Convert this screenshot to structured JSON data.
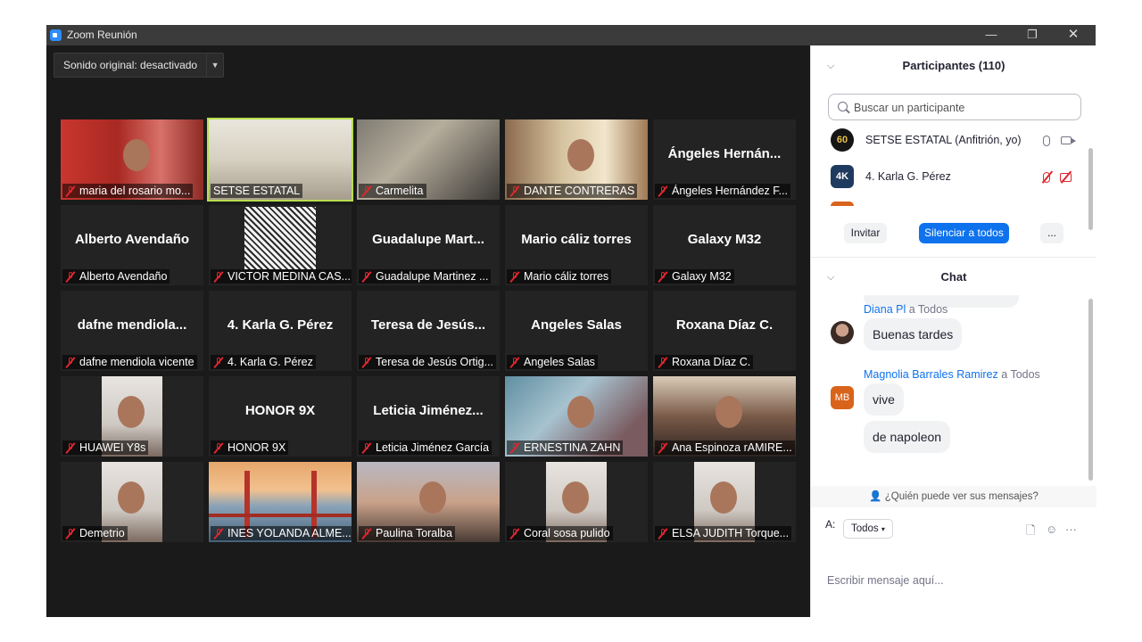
{
  "window": {
    "title": "Zoom Reunión",
    "minimize": "—",
    "restore": "❐",
    "close": "✕"
  },
  "meeting": {
    "sound_label": "Sonido original: desactivado",
    "dropdown_icon": "▼",
    "tiles": [
      {
        "name": "maria del rosario mo...",
        "big": "",
        "video": "redwall",
        "muted": true
      },
      {
        "name": "SETSE ESTATAL",
        "big": "",
        "video": "room",
        "muted": false,
        "selected": true
      },
      {
        "name": "Carmelita",
        "big": "",
        "video": "dark",
        "muted": true
      },
      {
        "name": "DANTE CONTRERAS",
        "big": "",
        "video": "warm",
        "muted": true
      },
      {
        "name": "Ángeles Hernández F...",
        "big": "Ángeles  Hernán...",
        "video": "",
        "muted": true
      },
      {
        "name": "Alberto Avendaño",
        "big": "Alberto Avendaño",
        "video": "",
        "muted": true
      },
      {
        "name": "VICTOR MEDINA CAS...",
        "big": "",
        "video": "lion",
        "muted": true
      },
      {
        "name": "Guadalupe Martinez ...",
        "big": "Guadalupe  Mart...",
        "video": "",
        "muted": true
      },
      {
        "name": "Mario cáliz torres",
        "big": "Mario cáliz torres",
        "video": "",
        "muted": true
      },
      {
        "name": "Galaxy M32",
        "big": "Galaxy M32",
        "video": "",
        "muted": true
      },
      {
        "name": "dafne mendiola vicente",
        "big": "dafne  mendiola...",
        "video": "",
        "muted": true
      },
      {
        "name": "4. Karla G. Pérez",
        "big": "4. Karla G. Pérez",
        "video": "",
        "muted": true
      },
      {
        "name": "Teresa de Jesús Ortig...",
        "big": "Teresa de Jesús...",
        "video": "",
        "muted": true
      },
      {
        "name": "Angeles Salas",
        "big": "Angeles Salas",
        "video": "",
        "muted": true
      },
      {
        "name": "Roxana Díaz C.",
        "big": "Roxana Díaz C.",
        "video": "",
        "muted": true
      },
      {
        "name": "HUAWEI Y8s",
        "big": "",
        "video": "light",
        "muted": true
      },
      {
        "name": "HONOR 9X",
        "big": "HONOR 9X",
        "video": "",
        "muted": true
      },
      {
        "name": "Leticia Jiménez García",
        "big": "Leticia  Jiménez...",
        "video": "",
        "muted": true
      },
      {
        "name": "ERNESTINA ZAHN",
        "big": "",
        "video": "teal",
        "muted": true
      },
      {
        "name": "Ana Espinoza rAMIRE...",
        "big": "",
        "video": "shop",
        "muted": true
      },
      {
        "name": "Demetrio",
        "big": "",
        "video": "light",
        "muted": true
      },
      {
        "name": "INES YOLANDA ALME...",
        "big": "",
        "video": "bridge",
        "muted": true
      },
      {
        "name": "Paulina Toralba",
        "big": "",
        "video": "skin",
        "muted": true
      },
      {
        "name": "Coral sosa pulido",
        "big": "",
        "video": "light",
        "muted": true
      },
      {
        "name": "ELSA JUDITH Torque...",
        "big": "",
        "video": "light",
        "muted": true
      }
    ]
  },
  "participants": {
    "title": "Participantes (110)",
    "search_placeholder": "Buscar un participante",
    "rows": [
      {
        "avatar": "60",
        "name": "SETSE ESTATAL (Anfitrión, yo)"
      },
      {
        "avatar": "4K",
        "name": "4. Karla G. Pérez"
      }
    ],
    "invite": "Invitar",
    "mute_all": "Silenciar a todos",
    "more": "..."
  },
  "chat": {
    "title": "Chat",
    "messages": [
      {
        "sender": "Diana Pl",
        "to": "a Todos",
        "texts": [
          "Buenas tardes"
        ]
      },
      {
        "sender": "Magnolia Barrales Ramirez",
        "to": "a Todos",
        "initials": "MB",
        "texts": [
          "vive",
          "de napoleon"
        ]
      }
    ],
    "who_can_see": "¿Quién puede ver sus mensajes?",
    "to_label": "A:",
    "recipient": "Todos",
    "input_placeholder": "Escribir mensaje aquí...",
    "more_icon": "···"
  },
  "colors": {
    "accent": "#0e72ed",
    "muted": "#e0262e",
    "active_speaker": "#b8df4f",
    "mb_avatar": "#d9631a"
  }
}
